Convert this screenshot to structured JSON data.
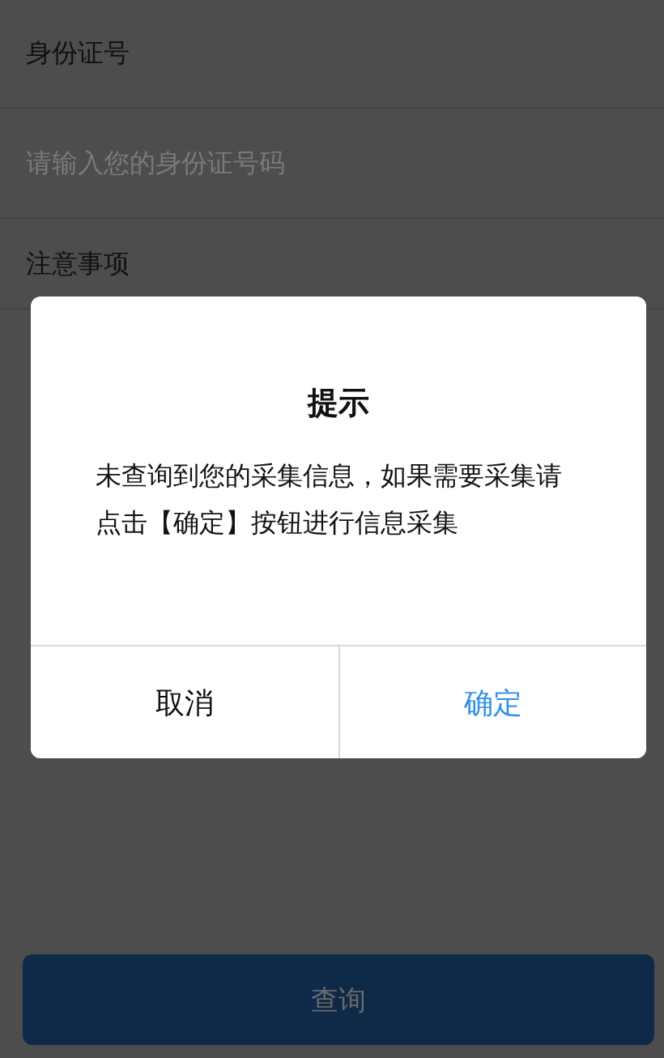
{
  "form": {
    "id_label": "身份证号",
    "id_placeholder": "请输入您的身份证号码",
    "notice_title": "注意事项",
    "query_button": "查询"
  },
  "dialog": {
    "title": "提示",
    "message": "未查询到您的采集信息，如果需要采集请点击【确定】按钮进行信息采集",
    "buttons": [
      {
        "label": "取消",
        "kind": "cancel"
      },
      {
        "label": "确定",
        "kind": "confirm"
      }
    ]
  }
}
